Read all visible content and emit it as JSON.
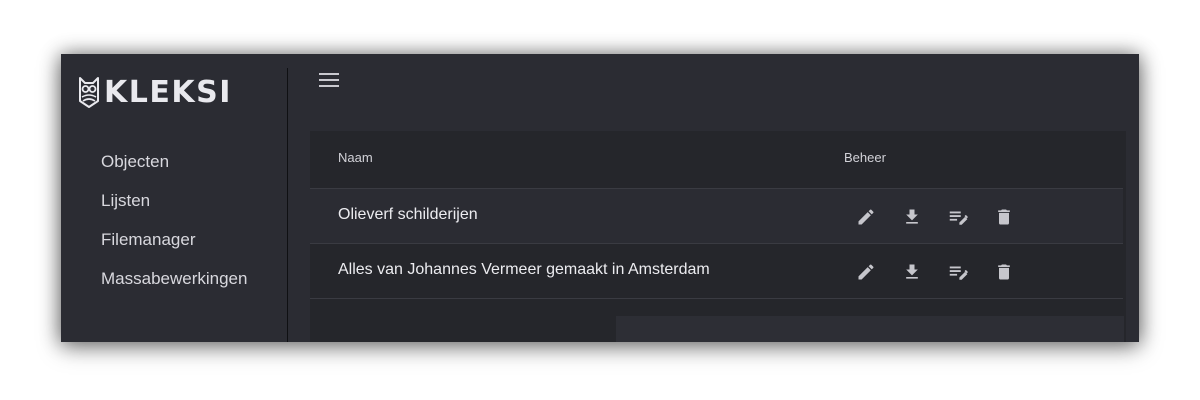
{
  "app": {
    "logo_text": "KLEKSI"
  },
  "sidebar": {
    "items": [
      {
        "label": "Objecten"
      },
      {
        "label": "Lijsten"
      },
      {
        "label": "Filemanager"
      },
      {
        "label": "Massabewerkingen"
      }
    ]
  },
  "header": {
    "menu_icon": "hamburger-menu-icon"
  },
  "table": {
    "columns": [
      {
        "label": "Naam"
      },
      {
        "label": "Beheer"
      }
    ],
    "rows": [
      {
        "name": "Olieverf schilderijen"
      },
      {
        "name": "Alles van Johannes Vermeer gemaakt in Amsterdam"
      }
    ],
    "actions": [
      {
        "icon": "pencil-icon"
      },
      {
        "icon": "download-icon"
      },
      {
        "icon": "edit-list-icon"
      },
      {
        "icon": "trash-icon"
      }
    ]
  },
  "colors": {
    "background": "#2b2c33",
    "card": "#25262b",
    "text": "#ececf0",
    "icon": "#c6c6cc"
  }
}
